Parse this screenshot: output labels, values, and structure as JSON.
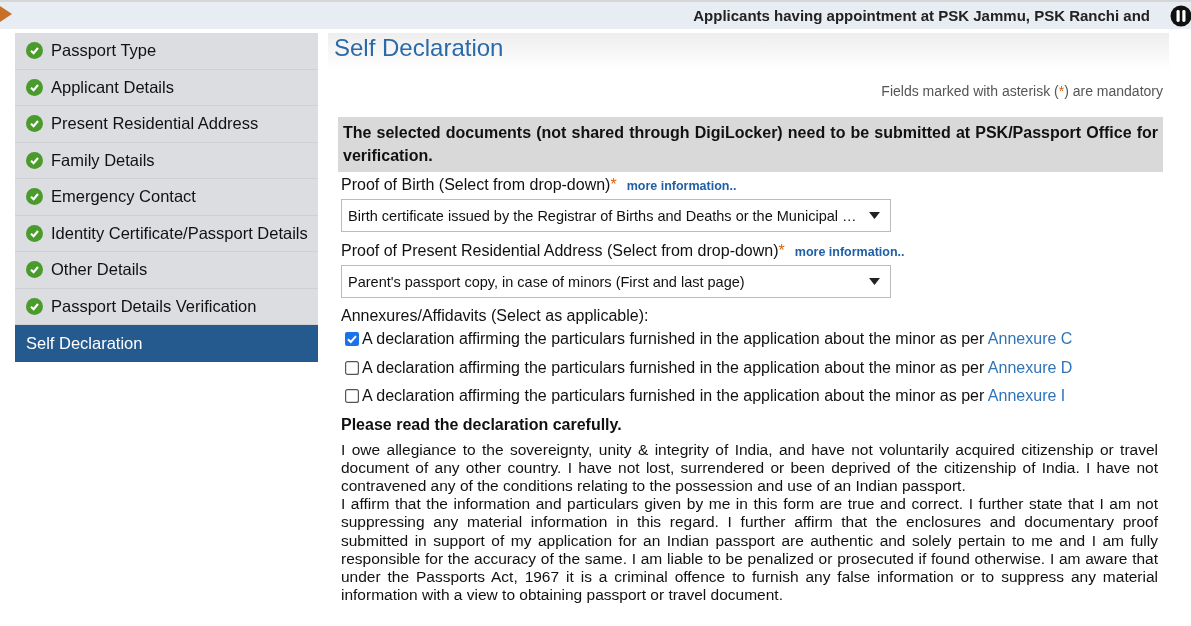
{
  "top_bar": {
    "marquee": "Applicants having appointment at PSK Jammu, PSK Ranchi and"
  },
  "sidebar": {
    "items": [
      {
        "label": "Passport Type",
        "completed": true,
        "selected": false
      },
      {
        "label": "Applicant Details",
        "completed": true,
        "selected": false
      },
      {
        "label": "Present Residential Address",
        "completed": true,
        "selected": false
      },
      {
        "label": "Family Details",
        "completed": true,
        "selected": false
      },
      {
        "label": "Emergency Contact",
        "completed": true,
        "selected": false
      },
      {
        "label": "Identity Certificate/Passport Details",
        "completed": true,
        "selected": false
      },
      {
        "label": "Other Details",
        "completed": true,
        "selected": false
      },
      {
        "label": "Passport Details Verification",
        "completed": true,
        "selected": false
      },
      {
        "label": "Self Declaration",
        "completed": false,
        "selected": true
      }
    ]
  },
  "page_title": "Self Declaration",
  "mandatory_note": {
    "before": "Fields marked with asterisk (",
    "mark": "*",
    "after": ") are mandatory"
  },
  "notice": "The selected documents (not shared through DigiLocker) need to be submitted at PSK/Passport Office for verification.",
  "fields": [
    {
      "label": "Proof of Birth (Select from drop-down)",
      "required": true,
      "link": "more information..",
      "value": "Birth certificate issued by the Registrar of Births and Deaths or the Municipal …"
    },
    {
      "label": "Proof of Present Residential Address (Select from drop-down)",
      "required": true,
      "link": "more information..",
      "value": "Parent's passport copy, in case of minors (First and last page)"
    }
  ],
  "annexures": {
    "label": "Annexures/Affidavits (Select as applicable):",
    "items": [
      {
        "text": "A declaration affirming the particulars furnished in the application about the minor as per",
        "link": "Annexure C",
        "checked": true
      },
      {
        "text": "A declaration affirming the particulars furnished in the application about the minor as per",
        "link": "Annexure D",
        "checked": false
      },
      {
        "text": "A declaration affirming the particulars furnished in the application about the minor as per",
        "link": "Annexure I",
        "checked": false
      }
    ]
  },
  "declaration": {
    "heading": "Please read the declaration carefully.",
    "paragraphs": [
      "I owe allegiance to the sovereignty, unity & integrity of India, and have not voluntarily acquired citizenship or travel document of any other country. I have not lost, surrendered or been deprived of the citizenship of India. I have not contravened any of the conditions relating to the possession and use of an Indian passport.",
      "I affirm that the information and particulars given by me in this form are true and correct. I further state that I am not suppressing any material information in this regard. I further affirm that the enclosures and documentary proof submitted in support of my application for an Indian passport are authentic and solely pertain to me and I am fully responsible for the accuracy of the same. I am liable to be penalized or prosecuted if found otherwise. I am aware that under the Passports Act, 1967 it is a criminal offence to furnish any false information or to suppress any material information with a view to obtaining passport or travel document."
    ]
  }
}
